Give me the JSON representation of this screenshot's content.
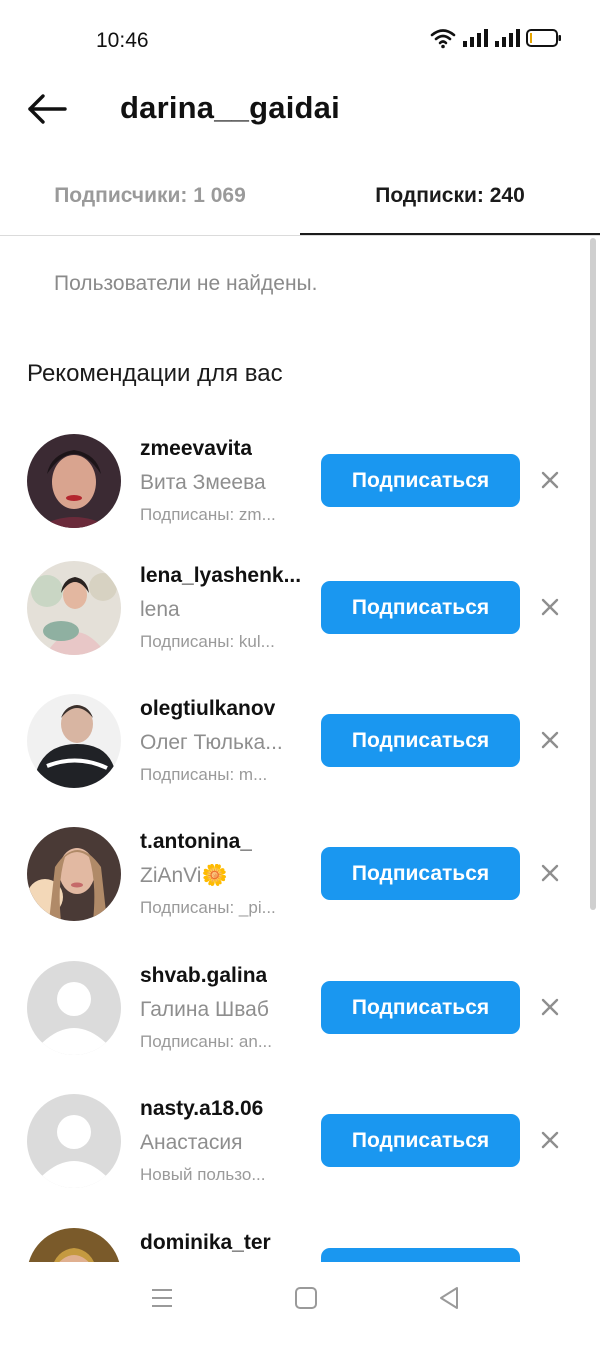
{
  "status_bar": {
    "time": "10:46"
  },
  "header": {
    "title": "darina__gaidai"
  },
  "tabs": [
    {
      "label": "Подписчики: 1 069"
    },
    {
      "label": "Подписки: 240"
    }
  ],
  "empty_state": "Пользователи не найдены.",
  "recommendations": {
    "title": "Рекомендации для вас",
    "follow_label": "Подписаться",
    "items": [
      {
        "username": "zmeevavita",
        "full_name": "Вита Змеева",
        "mutual": "Подписаны: zm..."
      },
      {
        "username": "lena_lyashenk...",
        "full_name": "lena",
        "mutual": "Подписаны: kul..."
      },
      {
        "username": "olegtiulkanov",
        "full_name": "Олег Тюлька...",
        "mutual": "Подписаны: m..."
      },
      {
        "username": "t.antonina_",
        "full_name": "ZiAnVi🌼",
        "mutual": "Подписаны: _pi..."
      },
      {
        "username": "shvab.galina",
        "full_name": "Галина Шваб",
        "mutual": "Подписаны: an..."
      },
      {
        "username": "nasty.a18.06",
        "full_name": "Анастасия",
        "mutual": "Новый пользо..."
      },
      {
        "username": "dominika_ter",
        "full_name": "",
        "mutual": ""
      }
    ]
  },
  "colors": {
    "accent": "#1a97f0",
    "muted_text": "#8e8e8e"
  }
}
